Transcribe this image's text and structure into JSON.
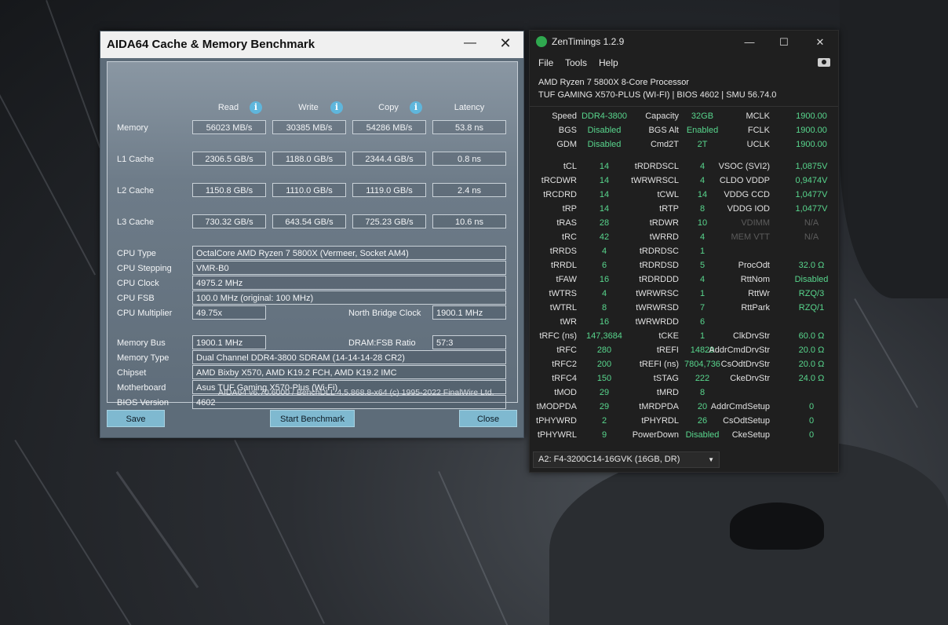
{
  "aida": {
    "title": "AIDA64 Cache & Memory Benchmark",
    "minimize_glyph": "—",
    "close_glyph": "✕",
    "columns": {
      "read": "Read",
      "write": "Write",
      "copy": "Copy",
      "latency": "Latency"
    },
    "info_glyph": "i",
    "rows": [
      {
        "label": "Memory",
        "read": "56023 MB/s",
        "write": "30385 MB/s",
        "copy": "54286 MB/s",
        "latency": "53.8 ns"
      },
      {
        "label": "L1 Cache",
        "read": "2306.5 GB/s",
        "write": "1188.0 GB/s",
        "copy": "2344.4 GB/s",
        "latency": "0.8 ns"
      },
      {
        "label": "L2 Cache",
        "read": "1150.8 GB/s",
        "write": "1110.0 GB/s",
        "copy": "1119.0 GB/s",
        "latency": "2.4 ns"
      },
      {
        "label": "L3 Cache",
        "read": "730.32 GB/s",
        "write": "643.54 GB/s",
        "copy": "725.23 GB/s",
        "latency": "10.6 ns"
      }
    ],
    "cpu": {
      "type_label": "CPU Type",
      "type": "OctalCore AMD Ryzen 7 5800X  (Vermeer, Socket AM4)",
      "stepping_label": "CPU Stepping",
      "stepping": "VMR-B0",
      "clock_label": "CPU Clock",
      "clock": "4975.2 MHz",
      "fsb_label": "CPU FSB",
      "fsb": "100.0 MHz  (original: 100 MHz)",
      "mult_label": "CPU Multiplier",
      "mult": "49.75x",
      "nb_label": "North Bridge Clock",
      "nb": "1900.1 MHz"
    },
    "mem": {
      "bus_label": "Memory Bus",
      "bus": "1900.1 MHz",
      "ratio_label": "DRAM:FSB Ratio",
      "ratio": "57:3",
      "type_label": "Memory Type",
      "type": "Dual Channel DDR4-3800 SDRAM  (14-14-14-28 CR2)",
      "chipset_label": "Chipset",
      "chipset": "AMD Bixby X570, AMD K19.2 FCH, AMD K19.2 IMC",
      "mobo_label": "Motherboard",
      "mobo": "Asus TUF Gaming X570-Plus (Wi-Fi)",
      "bios_label": "BIOS Version",
      "bios": "4602"
    },
    "version": "AIDA64 v6.70.6000 / BenchDLL 4.5.868.8-x64  (c) 1995-2022 FinalWire Ltd.",
    "buttons": {
      "save": "Save",
      "start": "Start Benchmark",
      "close": "Close"
    }
  },
  "zen": {
    "title": "ZenTimings 1.2.9",
    "min_glyph": "—",
    "max_glyph": "☐",
    "close_glyph": "✕",
    "menu": {
      "file": "File",
      "tools": "Tools",
      "help": "Help"
    },
    "cpu_line": "AMD Ryzen 7 5800X 8-Core Processor",
    "board_line": "TUF GAMING X570-PLUS (WI-FI) | BIOS 4602 | SMU 56.74.0",
    "top": [
      [
        "Speed",
        "DDR4-3800",
        "Capacity",
        "32GB",
        "MCLK",
        "1900.00"
      ],
      [
        "BGS",
        "Disabled",
        "BGS Alt",
        "Enabled",
        "FCLK",
        "1900.00"
      ],
      [
        "GDM",
        "Disabled",
        "Cmd2T",
        "2T",
        "UCLK",
        "1900.00"
      ]
    ],
    "timings": [
      [
        "tCL",
        "14",
        "tRDRDSCL",
        "4",
        "VSOC (SVI2)",
        "1,0875V"
      ],
      [
        "tRCDWR",
        "14",
        "tWRWRSCL",
        "4",
        "CLDO VDDP",
        "0,9474V"
      ],
      [
        "tRCDRD",
        "14",
        "tCWL",
        "14",
        "VDDG CCD",
        "1,0477V"
      ],
      [
        "tRP",
        "14",
        "tRTP",
        "8",
        "VDDG IOD",
        "1,0477V"
      ],
      [
        "tRAS",
        "28",
        "tRDWR",
        "10",
        "VDIMM",
        "N/A"
      ],
      [
        "tRC",
        "42",
        "tWRRD",
        "4",
        "MEM VTT",
        "N/A"
      ],
      [
        "tRRDS",
        "4",
        "tRDRDSC",
        "1",
        "",
        ""
      ],
      [
        "tRRDL",
        "6",
        "tRDRDSD",
        "5",
        "ProcOdt",
        "32.0 Ω"
      ],
      [
        "tFAW",
        "16",
        "tRDRDDD",
        "4",
        "RttNom",
        "Disabled"
      ],
      [
        "tWTRS",
        "4",
        "tWRWRSC",
        "1",
        "RttWr",
        "RZQ/3"
      ],
      [
        "tWTRL",
        "8",
        "tWRWRSD",
        "7",
        "RttPark",
        "RZQ/1"
      ],
      [
        "tWR",
        "16",
        "tWRWRDD",
        "6",
        "",
        ""
      ],
      [
        "tRFC (ns)",
        "147,3684",
        "tCKE",
        "1",
        "ClkDrvStr",
        "60.0 Ω"
      ],
      [
        "tRFC",
        "280",
        "tREFI",
        "14829",
        "AddrCmdDrvStr",
        "20.0 Ω"
      ],
      [
        "tRFC2",
        "200",
        "tREFI (ns)",
        "7804,736",
        "CsOdtDrvStr",
        "20.0 Ω"
      ],
      [
        "tRFC4",
        "150",
        "tSTAG",
        "222",
        "CkeDrvStr",
        "24.0 Ω"
      ],
      [
        "tMOD",
        "29",
        "tMRD",
        "8",
        "",
        ""
      ],
      [
        "tMODPDA",
        "29",
        "tMRDPDA",
        "20",
        "AddrCmdSetup",
        "0"
      ],
      [
        "tPHYWRD",
        "2",
        "tPHYRDL",
        "26",
        "CsOdtSetup",
        "0"
      ],
      [
        "tPHYWRL",
        "9",
        "PowerDown",
        "Disabled",
        "CkeSetup",
        "0"
      ]
    ],
    "dimm_select": "A2: F4-3200C14-16GVK (16GB, DR)",
    "dropdown_glyph": "▼",
    "colors": {
      "value_green": "#58d68d",
      "dim_gray": "#5c5c5c"
    }
  }
}
